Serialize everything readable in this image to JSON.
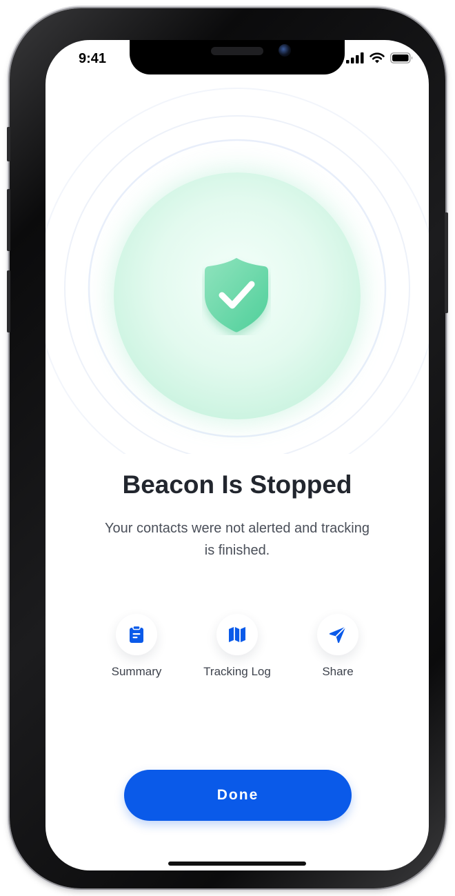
{
  "status_bar": {
    "time": "9:41",
    "icons": [
      "cellular-signal-icon",
      "wifi-icon",
      "battery-icon"
    ]
  },
  "hero": {
    "icon": "shield-check-icon",
    "accent_color": "#4fcf9a"
  },
  "title": "Beacon Is Stopped",
  "subtitle": "Your contacts were not alerted and tracking is finished.",
  "actions": [
    {
      "label": "Summary",
      "icon": "clipboard-icon"
    },
    {
      "label": "Tracking Log",
      "icon": "map-icon"
    },
    {
      "label": "Share",
      "icon": "send-icon"
    }
  ],
  "primary_button": {
    "label": "Done",
    "color": "#0a5ae9"
  }
}
